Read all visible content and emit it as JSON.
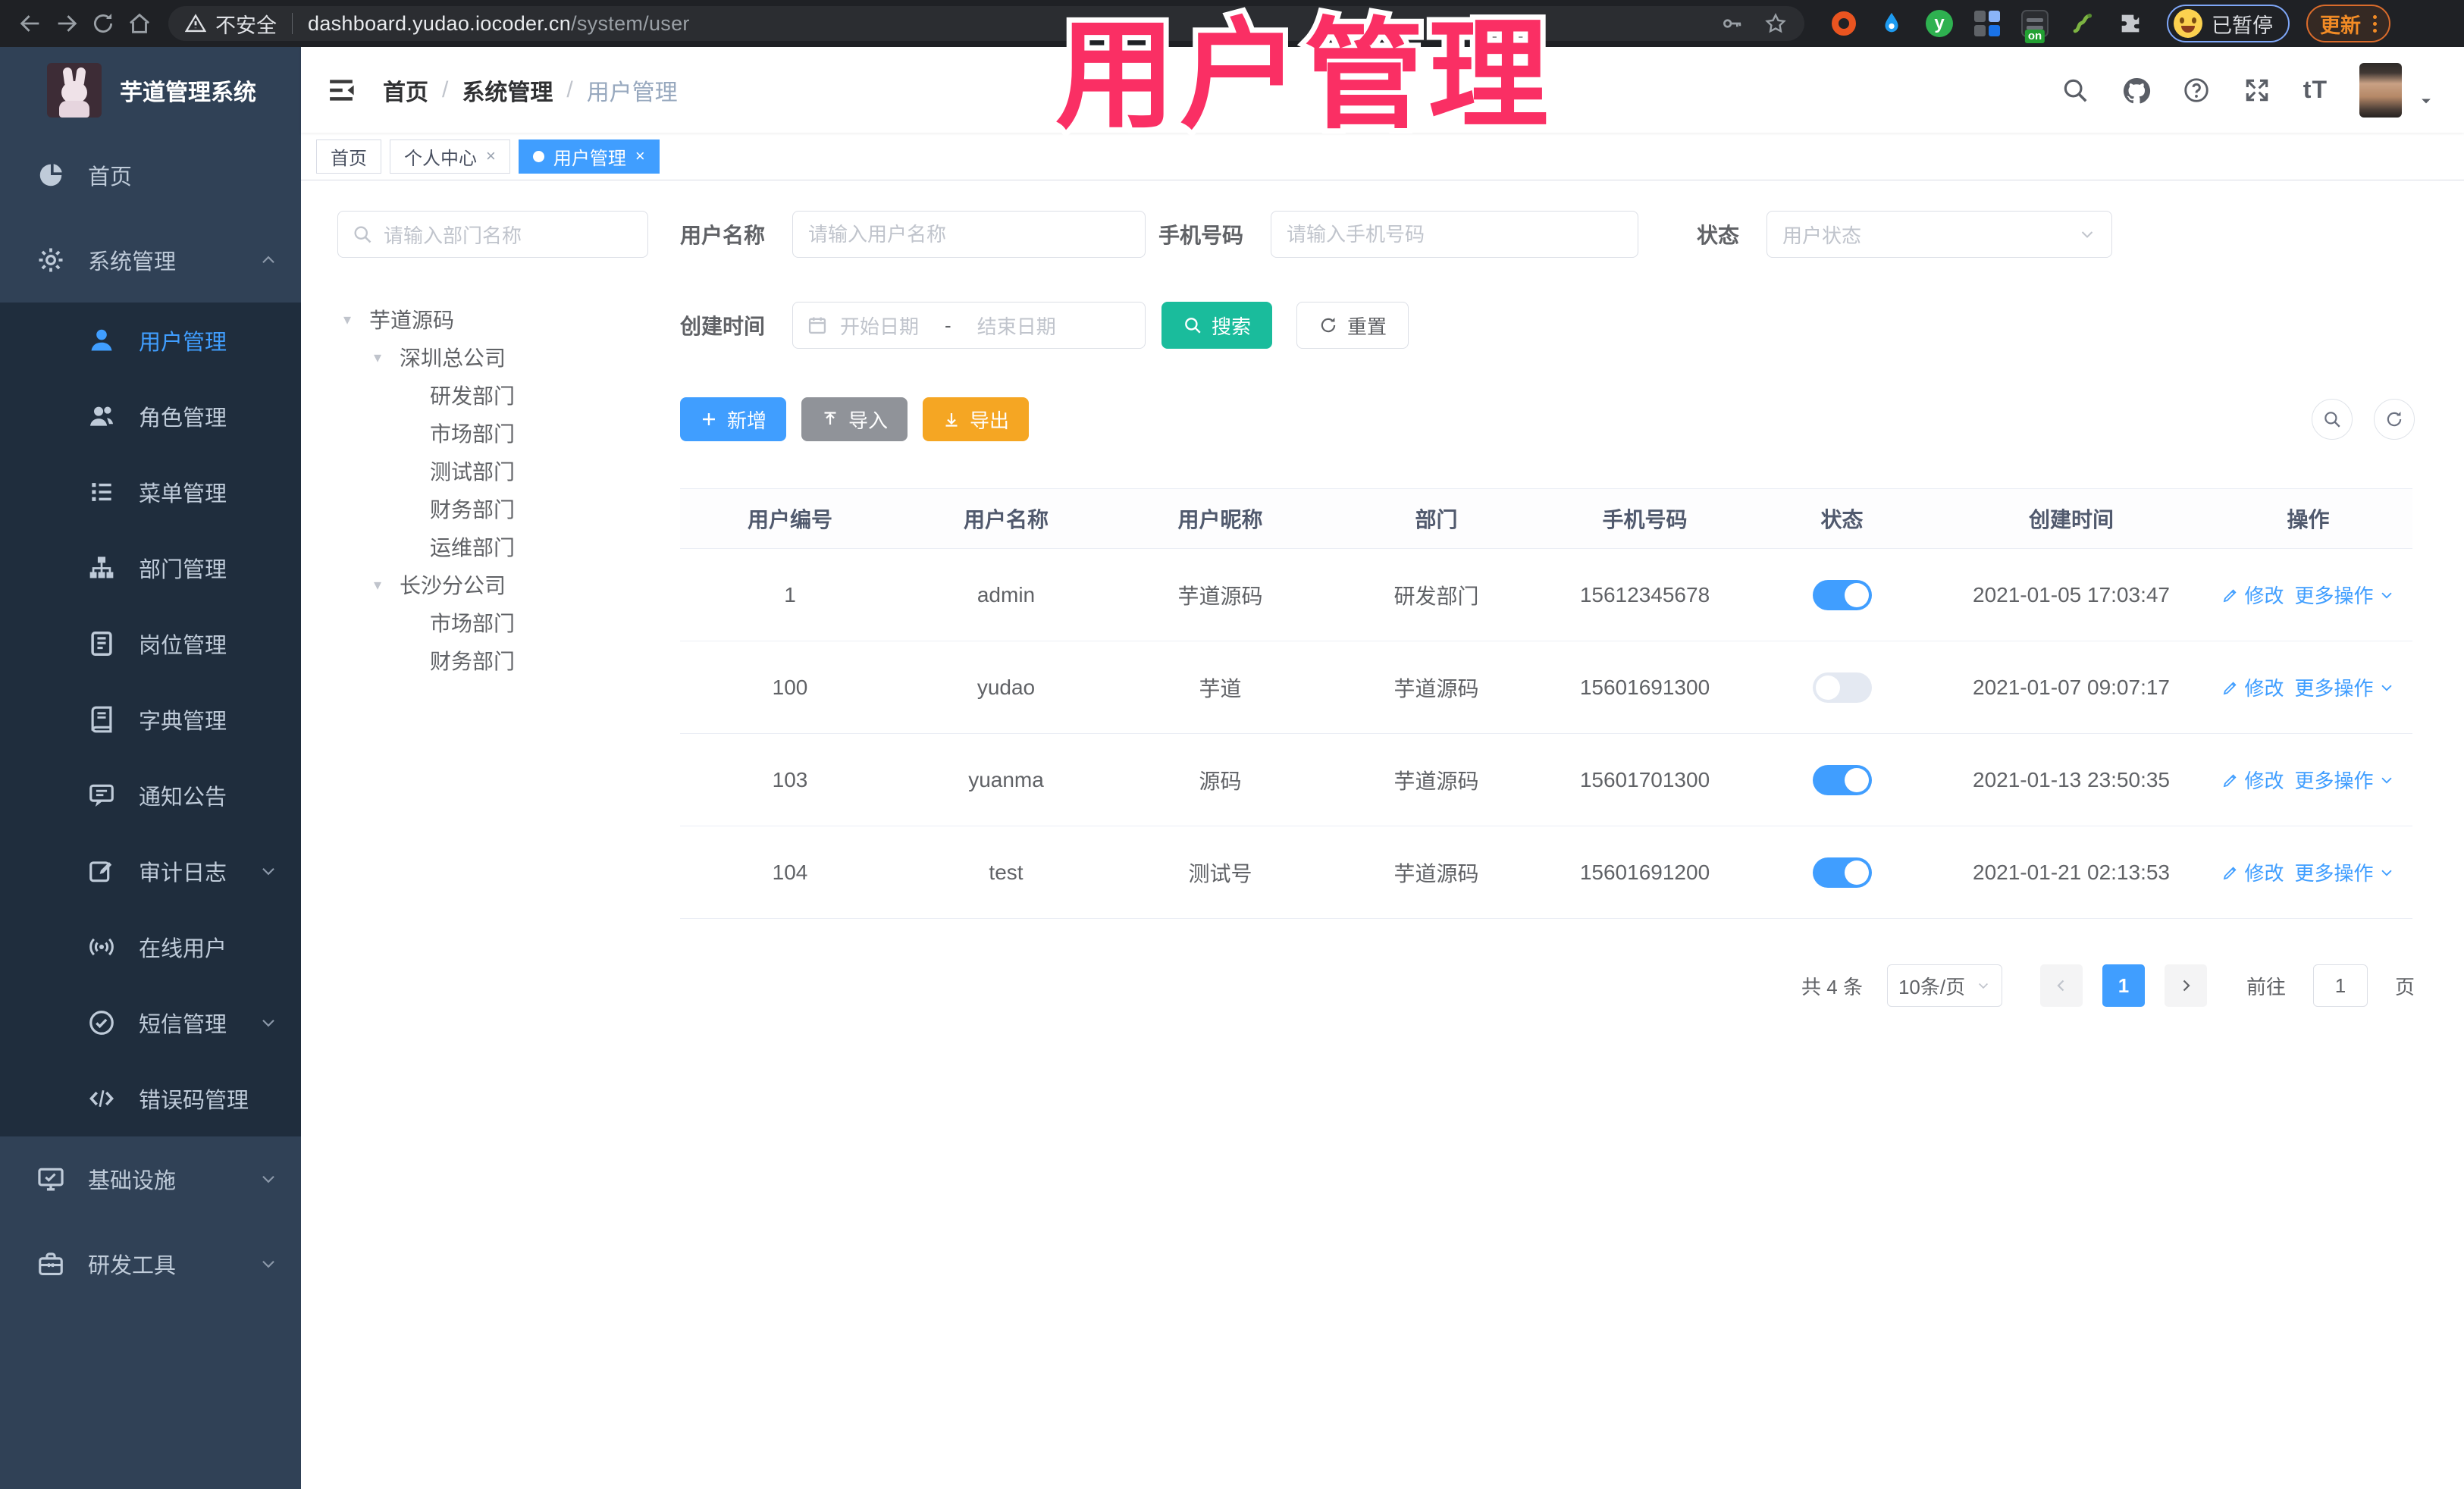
{
  "browser": {
    "security_label": "不安全",
    "url_host": "dashboard.yudao.iocoder.cn",
    "url_path": "/system/user",
    "profile_badge": "已暂停",
    "update_label": "更新",
    "extension_yu_letter": "y",
    "extension_on_badge": "on"
  },
  "watermark": "用户管理",
  "sidebar": {
    "logo_title": "芋道管理系统",
    "items": [
      {
        "label": "首页",
        "icon": "dashboard-icon",
        "level": "top"
      },
      {
        "label": "系统管理",
        "icon": "gear-icon",
        "level": "top",
        "chevron": "up"
      },
      {
        "label": "用户管理",
        "icon": "user-icon",
        "level": "sub",
        "active": true
      },
      {
        "label": "角色管理",
        "icon": "users-icon",
        "level": "sub"
      },
      {
        "label": "菜单管理",
        "icon": "menu-list-icon",
        "level": "sub"
      },
      {
        "label": "部门管理",
        "icon": "org-tree-icon",
        "level": "sub"
      },
      {
        "label": "岗位管理",
        "icon": "badge-icon",
        "level": "sub"
      },
      {
        "label": "字典管理",
        "icon": "book-icon",
        "level": "sub"
      },
      {
        "label": "通知公告",
        "icon": "announcement-icon",
        "level": "sub"
      },
      {
        "label": "审计日志",
        "icon": "audit-log-icon",
        "level": "sub",
        "chevron": "down"
      },
      {
        "label": "在线用户",
        "icon": "online-users-icon",
        "level": "sub"
      },
      {
        "label": "短信管理",
        "icon": "check-circle-icon",
        "level": "sub",
        "chevron": "down"
      },
      {
        "label": "错误码管理",
        "icon": "code-icon",
        "level": "sub"
      },
      {
        "label": "基础设施",
        "icon": "monitor-icon",
        "level": "top",
        "chevron": "down"
      },
      {
        "label": "研发工具",
        "icon": "toolbox-icon",
        "level": "top",
        "chevron": "down"
      }
    ]
  },
  "header": {
    "breadcrumb": [
      "首页",
      "系统管理",
      "用户管理"
    ],
    "font_size_icon_label": "tT"
  },
  "tabs": [
    {
      "label": "首页",
      "closable": false,
      "active": false
    },
    {
      "label": "个人中心",
      "closable": true,
      "active": false
    },
    {
      "label": "用户管理",
      "closable": true,
      "active": true
    }
  ],
  "tree_panel": {
    "search_placeholder": "请输入部门名称",
    "nodes": [
      {
        "label": "芋道源码",
        "depth": 0,
        "caret": true
      },
      {
        "label": "深圳总公司",
        "depth": 1,
        "caret": true
      },
      {
        "label": "研发部门",
        "depth": 2,
        "caret": false
      },
      {
        "label": "市场部门",
        "depth": 2,
        "caret": false
      },
      {
        "label": "测试部门",
        "depth": 2,
        "caret": false
      },
      {
        "label": "财务部门",
        "depth": 2,
        "caret": false
      },
      {
        "label": "运维部门",
        "depth": 2,
        "caret": false
      },
      {
        "label": "长沙分公司",
        "depth": 1,
        "caret": true
      },
      {
        "label": "市场部门",
        "depth": 2,
        "caret": false
      },
      {
        "label": "财务部门",
        "depth": 2,
        "caret": false
      }
    ]
  },
  "filters": {
    "username_label": "用户名称",
    "username_placeholder": "请输入用户名称",
    "mobile_label": "手机号码",
    "mobile_placeholder": "请输入手机号码",
    "status_label": "状态",
    "status_placeholder": "用户状态",
    "create_time_label": "创建时间",
    "date_start_placeholder": "开始日期",
    "date_separator": "-",
    "date_end_placeholder": "结束日期",
    "search_button": "搜索",
    "reset_button": "重置"
  },
  "toolbar": {
    "add_button": "新增",
    "import_button": "导入",
    "export_button": "导出"
  },
  "table": {
    "columns": [
      "用户编号",
      "用户名称",
      "用户昵称",
      "部门",
      "手机号码",
      "状态",
      "创建时间",
      "操作"
    ],
    "edit_label": "修改",
    "more_label": "更多操作",
    "rows": [
      {
        "id": "1",
        "username": "admin",
        "nickname": "芋道源码",
        "dept": "研发部门",
        "mobile": "15612345678",
        "status_on": true,
        "created": "2021-01-05 17:03:47"
      },
      {
        "id": "100",
        "username": "yudao",
        "nickname": "芋道",
        "dept": "芋道源码",
        "mobile": "15601691300",
        "status_on": false,
        "created": "2021-01-07 09:07:17"
      },
      {
        "id": "103",
        "username": "yuanma",
        "nickname": "源码",
        "dept": "芋道源码",
        "mobile": "15601701300",
        "status_on": true,
        "created": "2021-01-13 23:50:35"
      },
      {
        "id": "104",
        "username": "test",
        "nickname": "测试号",
        "dept": "芋道源码",
        "mobile": "15601691200",
        "status_on": true,
        "created": "2021-01-21 02:13:53"
      }
    ]
  },
  "pagination": {
    "total_text": "共 4 条",
    "page_size": "10条/页",
    "current_page": "1",
    "goto_label": "前往",
    "goto_value": "1",
    "page_unit": "页"
  },
  "colors": {
    "accent_blue": "#409eff",
    "search_teal": "#1abc9c",
    "export_yellow": "#f5a623",
    "import_gray": "#909399",
    "sidebar_bg": "#304156",
    "submenu_bg": "#1f2d3d",
    "watermark_pink": "#fa2f64"
  }
}
